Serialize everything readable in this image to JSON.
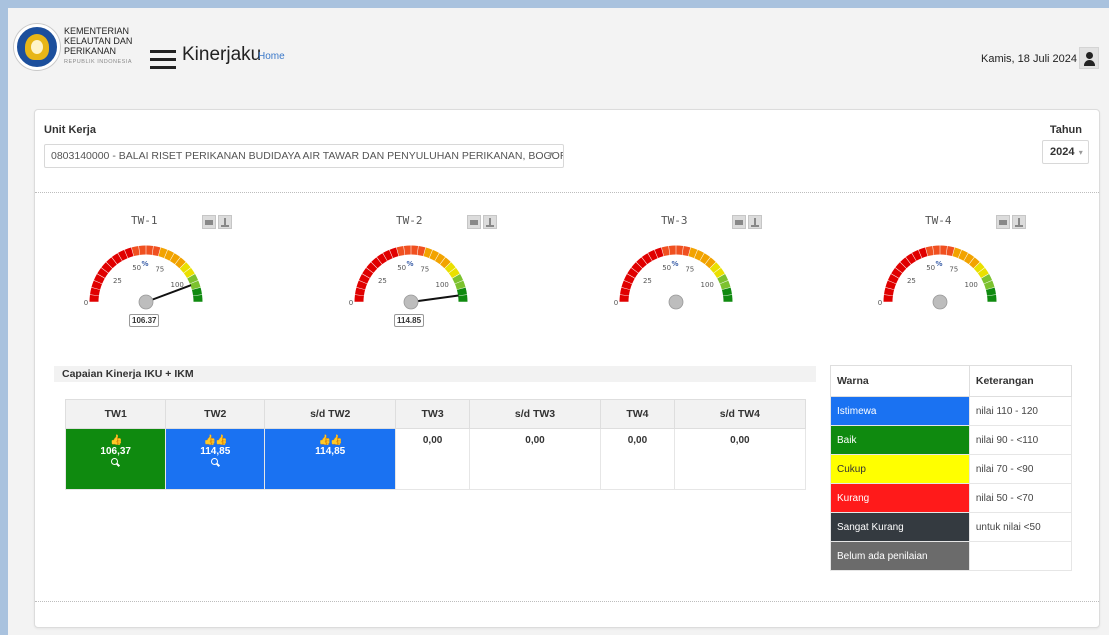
{
  "header": {
    "org_line1": "KEMENTERIAN",
    "org_line2": "KELAUTAN DAN",
    "org_line3": "PERIKANAN",
    "org_sub": "REPUBLIK INDONESIA",
    "app_title": "Kinerjaku",
    "home_link": "Home",
    "date": "Kamis, 18 Juli 2024",
    "menu_icon": "hamburger-menu-icon",
    "user_icon": "user-icon"
  },
  "filters": {
    "unit_label": "Unit Kerja",
    "unit_value": "0803140000 - BALAI RISET PERIKANAN BUDIDAYA AIR TAWAR DAN PENYULUHAN PERIKANAN, BOGOR",
    "tahun_label": "Tahun",
    "tahun_value": "2024"
  },
  "gauges": [
    {
      "title": "TW-1",
      "value": 106.37,
      "value_label": "106.37"
    },
    {
      "title": "TW-2",
      "value": 114.85,
      "value_label": "114.85"
    },
    {
      "title": "TW-3",
      "value": null,
      "value_label": ""
    },
    {
      "title": "TW-4",
      "value": null,
      "value_label": ""
    }
  ],
  "gauge_scale": {
    "min": 0,
    "max": 120,
    "ticks": [
      "0",
      "25",
      "50",
      "75",
      "100"
    ],
    "unit": "%"
  },
  "capaian": {
    "title": "Capaian Kinerja IKU + IKM",
    "headers": [
      "TW1",
      "TW2",
      "s/d TW2",
      "TW3",
      "s/d TW3",
      "TW4",
      "s/d TW4"
    ],
    "cells": [
      {
        "value": "106,37",
        "thumbs": "👍",
        "color": "#0f8a0f"
      },
      {
        "value": "114,85",
        "thumbs": "👍👍",
        "color": "#1a72f2"
      },
      {
        "value": "114,85",
        "thumbs": "👍👍",
        "color": "#1a72f2"
      },
      {
        "value": "0,00",
        "thumbs": "",
        "color": ""
      },
      {
        "value": "0,00",
        "thumbs": "",
        "color": ""
      },
      {
        "value": "0,00",
        "thumbs": "",
        "color": ""
      },
      {
        "value": "0,00",
        "thumbs": "",
        "color": ""
      }
    ]
  },
  "legend": {
    "col_warna": "Warna",
    "col_keterangan": "Keterangan",
    "rows": [
      {
        "label": "Istimewa",
        "desc": "nilai 110 - 120",
        "color": "#1a72f2"
      },
      {
        "label": "Baik",
        "desc": "nilai 90 - <110",
        "color": "#0f8a0f"
      },
      {
        "label": "Cukup",
        "desc": "nilai 70 - <90",
        "color": "#ffff00"
      },
      {
        "label": "Kurang",
        "desc": "nilai 50 - <70",
        "color": "#ff1a1a"
      },
      {
        "label": "Sangat Kurang",
        "desc": "untuk nilai <50",
        "color": "#343a40"
      },
      {
        "label": "Belum ada penilaian",
        "desc": "",
        "color": "#6b6b6b"
      }
    ]
  }
}
